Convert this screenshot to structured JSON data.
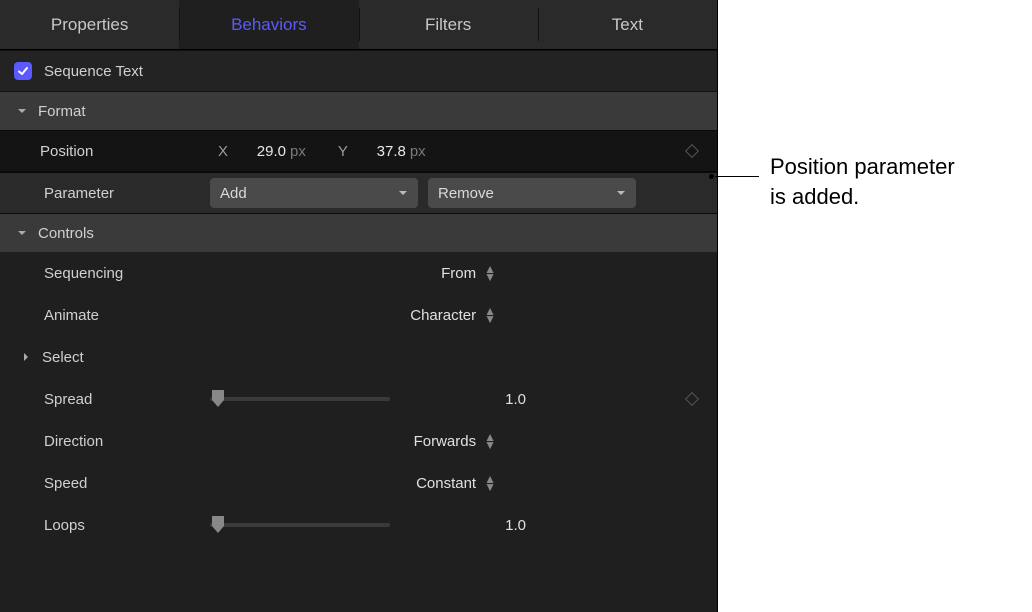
{
  "tabs": {
    "properties": "Properties",
    "behaviors": "Behaviors",
    "filters": "Filters",
    "text": "Text"
  },
  "header": {
    "title": "Sequence Text",
    "checked": true
  },
  "sections": {
    "format": "Format",
    "controls": "Controls"
  },
  "position": {
    "label": "Position",
    "xLabel": "X",
    "xValue": "29.0",
    "xUnit": "px",
    "yLabel": "Y",
    "yValue": "37.8",
    "yUnit": "px"
  },
  "parameter": {
    "label": "Parameter",
    "addLabel": "Add",
    "removeLabel": "Remove"
  },
  "controls": {
    "sequencing": {
      "label": "Sequencing",
      "value": "From"
    },
    "animate": {
      "label": "Animate",
      "value": "Character"
    },
    "select": {
      "label": "Select"
    },
    "spread": {
      "label": "Spread",
      "value": "1.0"
    },
    "direction": {
      "label": "Direction",
      "value": "Forwards"
    },
    "speed": {
      "label": "Speed",
      "value": "Constant"
    },
    "loops": {
      "label": "Loops",
      "value": "1.0"
    }
  },
  "annotation": {
    "line1": "Position parameter",
    "line2": "is added."
  }
}
